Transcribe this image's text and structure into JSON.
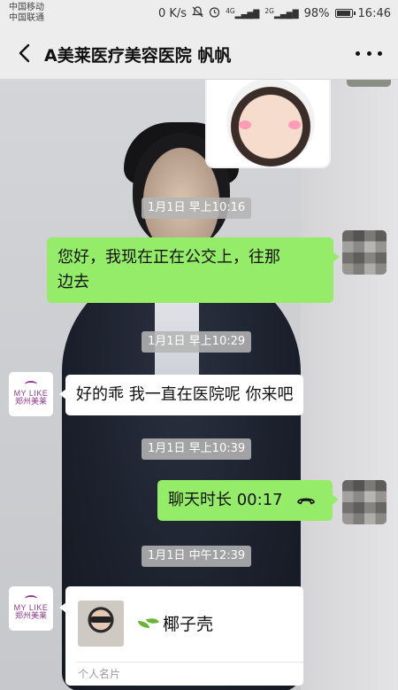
{
  "status_bar": {
    "carrier_1": "中国移动",
    "carrier_2": "中国联通",
    "net_speed": "0 K/s",
    "mute_icon": "bell-off-icon",
    "alarm_icon": "alarm-icon",
    "network_1": "4G",
    "network_2": "2G",
    "battery": "98%",
    "time": "16:46"
  },
  "header": {
    "back_icon": "chevron-left-icon",
    "title": "A美莱医疗美容医院 帆帆",
    "more_icon": "more-dots-icon"
  },
  "messages": [
    {
      "type": "timestamp",
      "text": "1月1日 早上10:16"
    },
    {
      "type": "text",
      "side": "right",
      "text_line_1": "您好，我现在正在公交上，往那",
      "text_line_2": "边去"
    },
    {
      "type": "timestamp",
      "text": "1月1日 早上10:29"
    },
    {
      "type": "text",
      "side": "left",
      "text": "好的乖 我一直在医院呢 你来吧"
    },
    {
      "type": "timestamp",
      "text": "1月1日 早上10:39"
    },
    {
      "type": "call",
      "side": "right",
      "text": "聊天时长 00:17",
      "icon": "phone-hangup-icon"
    },
    {
      "type": "timestamp",
      "text": "1月1日 中午12:39"
    },
    {
      "type": "contact_card",
      "side": "left",
      "name": "椰子壳",
      "label": "个人名片"
    }
  ],
  "clinic_avatar": {
    "logo_en": "MY LIKE",
    "logo_cn": "郑州美莱"
  },
  "colors": {
    "my_bubble": "#95ec69",
    "their_bubble": "#ffffff",
    "header_bg": "#ededed",
    "brand_purple": "#8e3a8b"
  }
}
